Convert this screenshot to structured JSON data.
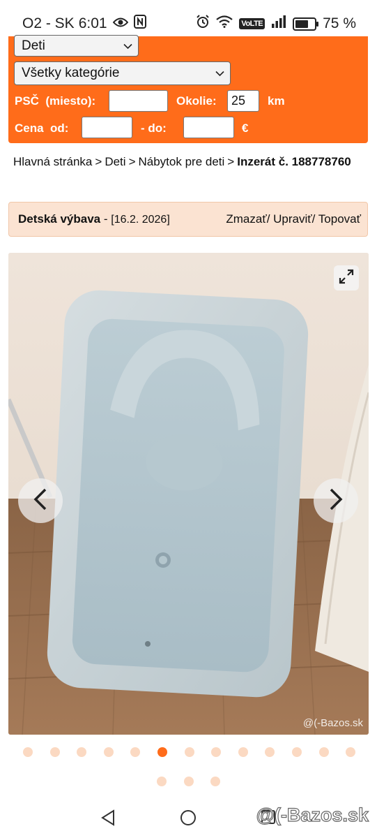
{
  "status_bar": {
    "carrier": "O2 - SK",
    "time": "6:01",
    "battery": "75 %",
    "battery_level": 0.75,
    "network_badge": "VoLTE",
    "icons": [
      "eye-icon",
      "nfc-icon",
      "alarm-icon",
      "wifi-icon",
      "signal-icon",
      "battery-icon"
    ]
  },
  "search": {
    "section_select": "Deti",
    "category_select": "Všetky kategórie",
    "psc_label": "PSČ  (miesto):",
    "psc_value": "",
    "okolie_label": "Okolie:",
    "okolie_value": "25",
    "okolie_unit": "km",
    "cena_label": "Cena  od:",
    "cena_from": "",
    "cena_to_label": "- do:",
    "cena_to": "",
    "currency": "€",
    "accent_color": "#ff6c1a"
  },
  "breadcrumb": {
    "items": [
      "Hlavná stránka",
      "Deti",
      "Nábytok pre deti"
    ],
    "separator": ">",
    "current": "Inzerát č. 188778760"
  },
  "ad": {
    "title": "Detská výbava",
    "title_sep": " - ",
    "date": "[16.2. 2026]",
    "actions": [
      "Zmazať",
      "Upraviť",
      "Topovať"
    ],
    "action_sep": "/ "
  },
  "gallery": {
    "watermark": "@(-Bazos.sk",
    "total_images": 16,
    "active_index": 5,
    "icons": [
      "expand-icon",
      "chevron-left-icon",
      "chevron-right-icon"
    ]
  },
  "nav_bar": {
    "watermark": "@(-Bazos.sk",
    "icons": [
      "back-icon",
      "home-icon",
      "recents-icon"
    ]
  }
}
